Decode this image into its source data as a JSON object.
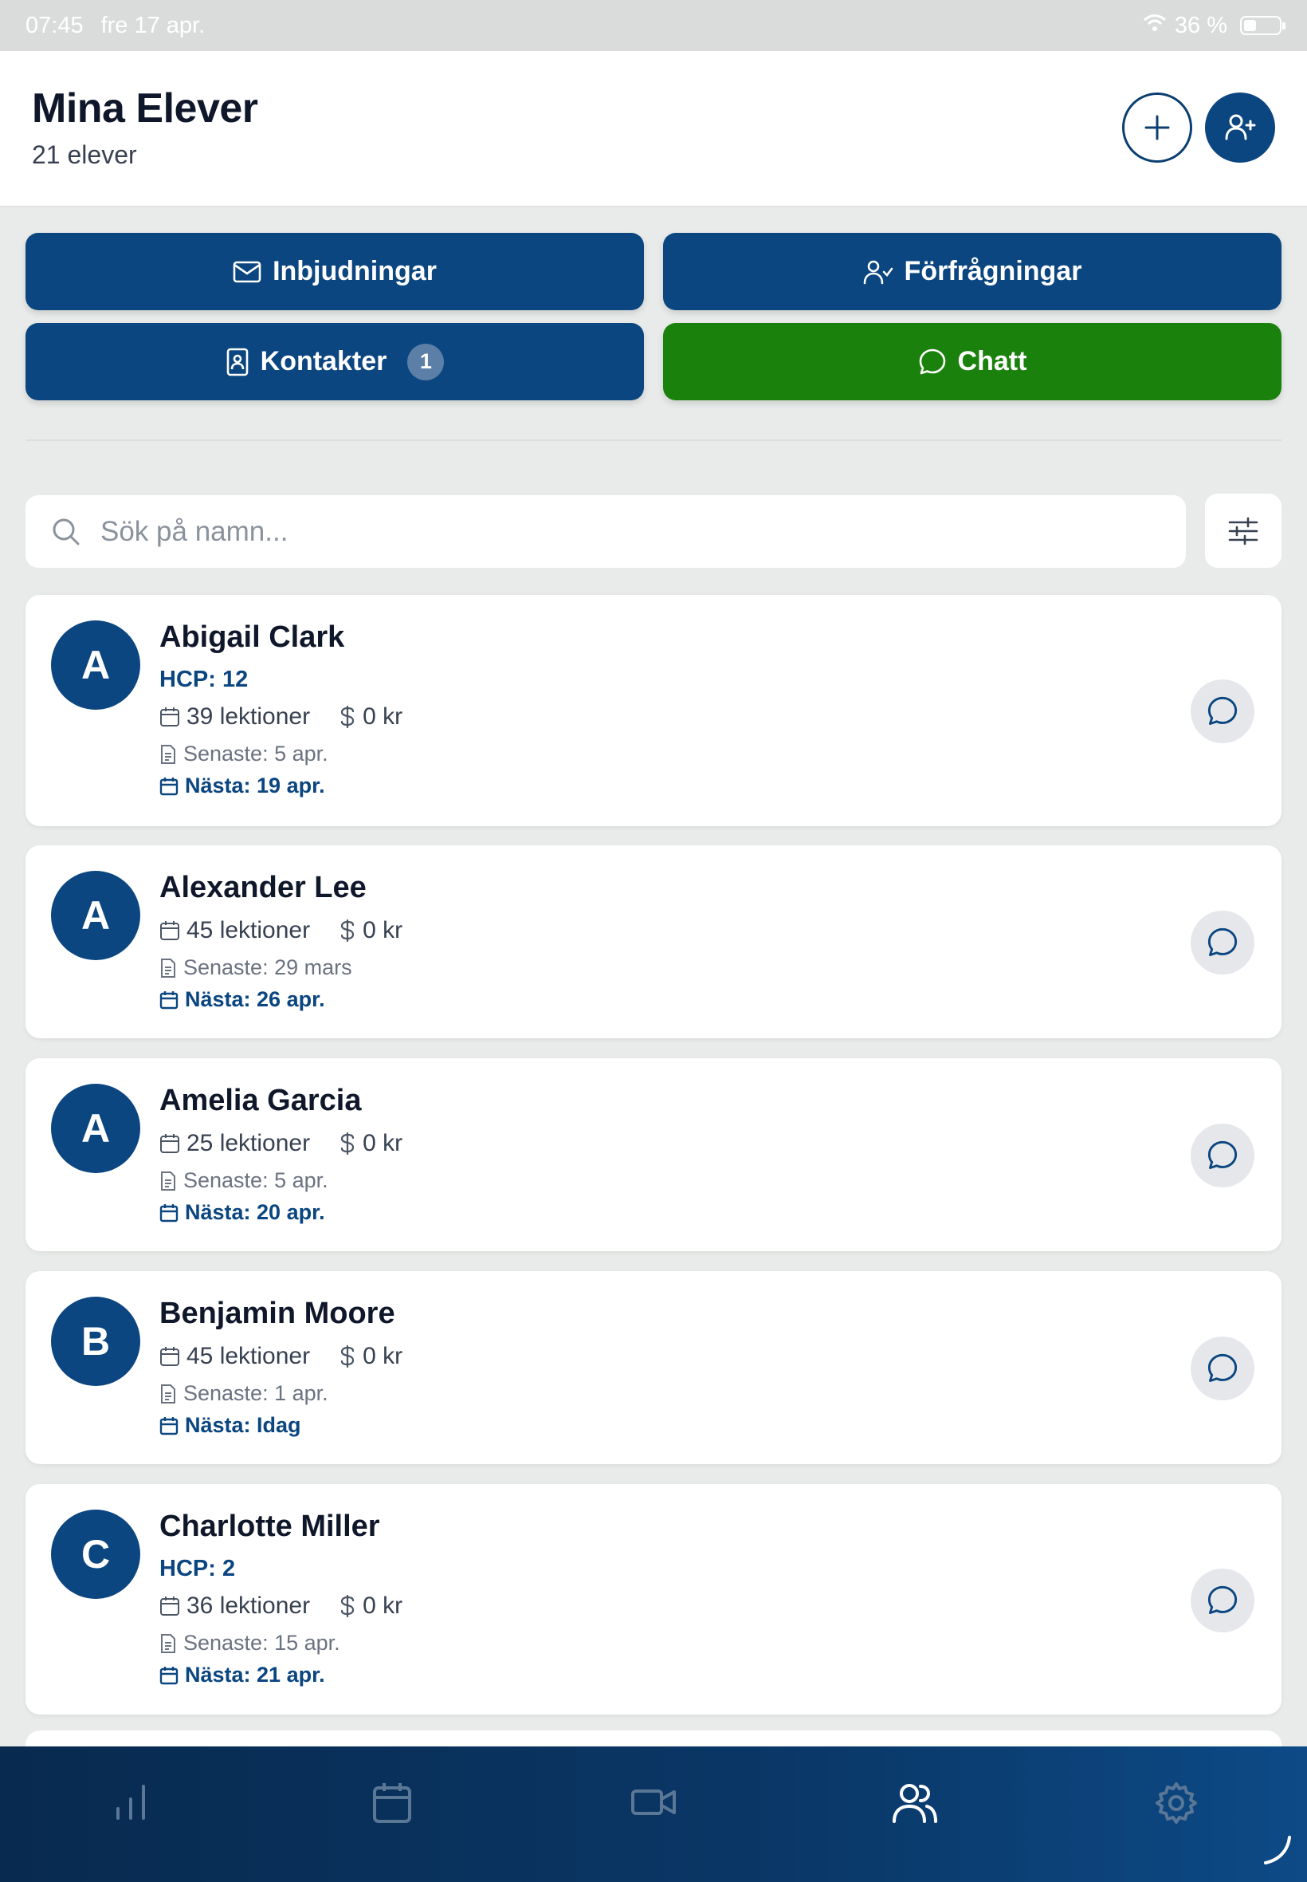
{
  "status_bar": {
    "time": "07:45",
    "date": "fre 17 apr.",
    "battery": "36 %"
  },
  "header": {
    "title": "Mina Elever",
    "subtitle": "21 elever"
  },
  "actions": {
    "invitations": "Inbjudningar",
    "requests": "Förfrågningar",
    "contacts": "Kontakter",
    "contacts_badge": "1",
    "chat": "Chatt"
  },
  "search": {
    "placeholder": "Sök på namn..."
  },
  "students": [
    {
      "initial": "A",
      "name": "Abigail Clark",
      "hcp": "HCP: 12",
      "lessons": "39 lektioner",
      "amount": "0 kr",
      "last": "Senaste: 5 apr.",
      "next": "Nästa: 19 apr."
    },
    {
      "initial": "A",
      "name": "Alexander Lee",
      "hcp": "",
      "lessons": "45 lektioner",
      "amount": "0 kr",
      "last": "Senaste: 29 mars",
      "next": "Nästa: 26 apr."
    },
    {
      "initial": "A",
      "name": "Amelia Garcia",
      "hcp": "",
      "lessons": "25 lektioner",
      "amount": "0 kr",
      "last": "Senaste: 5 apr.",
      "next": "Nästa: 20 apr."
    },
    {
      "initial": "B",
      "name": "Benjamin Moore",
      "hcp": "",
      "lessons": "45 lektioner",
      "amount": "0 kr",
      "last": "Senaste: 1 apr.",
      "next": "Nästa: Idag"
    },
    {
      "initial": "C",
      "name": "Charlotte Miller",
      "hcp": "HCP: 2",
      "lessons": "36 lektioner",
      "amount": "0 kr",
      "last": "Senaste: 15 apr.",
      "next": "Nästa: 21 apr."
    }
  ],
  "tab_bar": {
    "tabs": [
      "stats-icon",
      "calendar-icon",
      "video-icon",
      "users-icon",
      "settings-icon"
    ],
    "active": "users-icon"
  },
  "colors": {
    "primary": "#0b4680",
    "chat_green": "#1a820c",
    "background": "#e8ebe9"
  }
}
